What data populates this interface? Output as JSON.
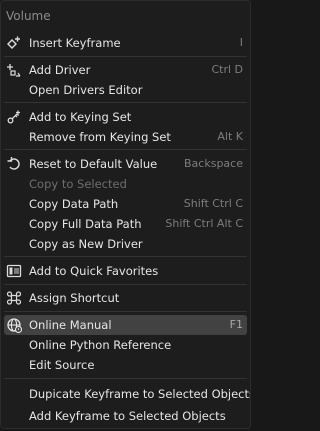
{
  "menu": {
    "title": "Volume",
    "items": [
      {
        "label": "Insert Keyframe",
        "shortcut": "I"
      },
      {
        "label": "Add Driver",
        "shortcut": "Ctrl D"
      },
      {
        "label": "Open Drivers Editor",
        "shortcut": ""
      },
      {
        "label": "Add to Keying Set",
        "shortcut": ""
      },
      {
        "label": "Remove from Keying Set",
        "shortcut": "Alt K"
      },
      {
        "label": "Reset to Default Value",
        "shortcut": "Backspace"
      },
      {
        "label": "Copy to Selected",
        "shortcut": "",
        "disabled": true
      },
      {
        "label": "Copy Data Path",
        "shortcut": "Shift Ctrl C"
      },
      {
        "label": "Copy Full Data Path",
        "shortcut": "Shift Ctrl Alt C"
      },
      {
        "label": "Copy as New Driver",
        "shortcut": ""
      },
      {
        "label": "Add to Quick Favorites",
        "shortcut": ""
      },
      {
        "label": "Assign Shortcut",
        "shortcut": ""
      },
      {
        "label": "Online Manual",
        "shortcut": "F1",
        "highlighted": true
      },
      {
        "label": "Online Python Reference",
        "shortcut": ""
      },
      {
        "label": "Edit Source",
        "shortcut": ""
      },
      {
        "label": "Dupicate Keyframe to Selected Objects",
        "shortcut": ""
      },
      {
        "label": "Add Keyframe to Selected Objects",
        "shortcut": ""
      }
    ]
  },
  "colors": {
    "background": "#1d1d1d",
    "highlight": "#424242",
    "text": "#e6e6e6",
    "muted": "#7d7d7d",
    "disabled": "#6e6e6e"
  }
}
